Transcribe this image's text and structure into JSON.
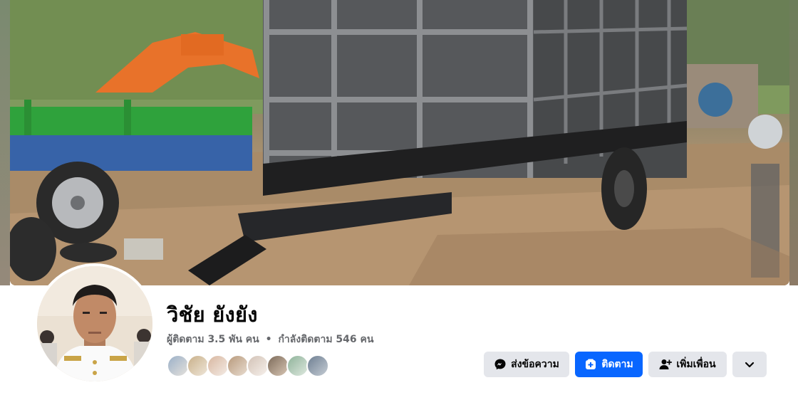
{
  "profile": {
    "name": "วิชัย ยังยัง",
    "followers": "ผู้ติดตาม 3.5 พัน คน",
    "separator": "•",
    "following": "กำลังติดตาม 546 คน"
  },
  "actions": {
    "message_label": "ส่งข้อความ",
    "follow_label": "ติดตาม",
    "add_friend_label": "เพิ่มเพื่อน"
  },
  "icons": {
    "message": "messenger-icon",
    "follow": "follow-icon",
    "add_friend": "add-friend-icon",
    "more": "chevron-down-icon"
  },
  "friends_preview": [
    {
      "color": "#9bb0c8"
    },
    {
      "color": "#c9b08a"
    },
    {
      "color": "#d8b7a0"
    },
    {
      "color": "#b89a7c"
    },
    {
      "color": "#d2c2b6"
    },
    {
      "color": "#7d6b5a"
    },
    {
      "color": "#8fb39a"
    },
    {
      "color": "#6e7f92"
    }
  ],
  "colors": {
    "primary": "#0866ff",
    "secondary_button": "#e4e6eb",
    "text_primary": "#050505",
    "text_secondary": "#65676b"
  }
}
